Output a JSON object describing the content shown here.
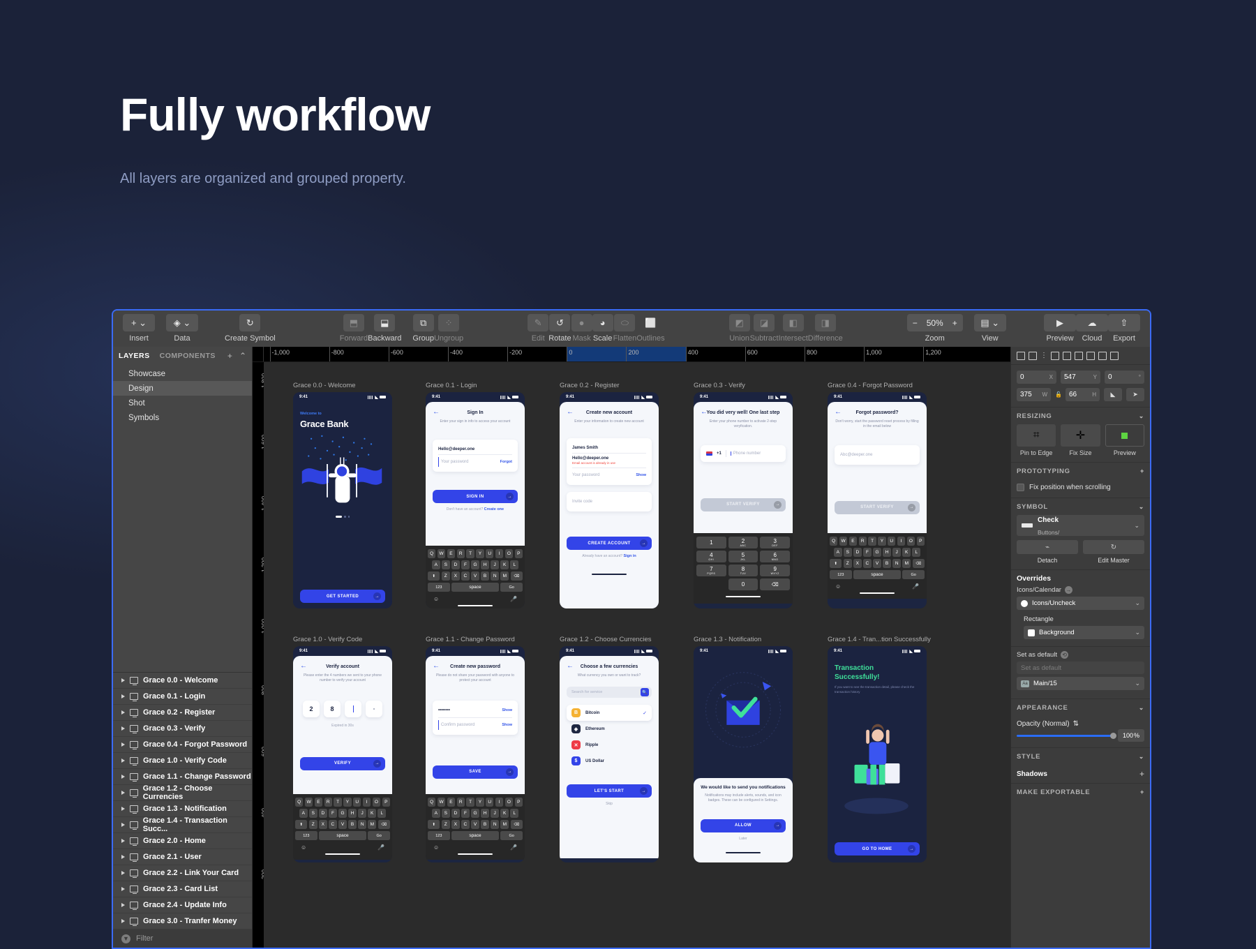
{
  "hero": {
    "title": "Fully workflow",
    "subtitle": "All layers are  organized and grouped property."
  },
  "toolbar": {
    "groups": [
      {
        "label": "Insert",
        "icon": "plus-icon",
        "dim": false
      },
      {
        "label": "Data",
        "icon": "layers-icon",
        "dim": false
      },
      {
        "label": "Create Symbol",
        "icon": "symbol-icon",
        "dim": false
      },
      {
        "label": "Forward",
        "icon": "forward-icon",
        "dim": true
      },
      {
        "label": "Backward",
        "icon": "backward-icon",
        "dim": false
      },
      {
        "label": "Group",
        "icon": "group-icon",
        "dim": false
      },
      {
        "label": "Ungroup",
        "icon": "ungroup-icon",
        "dim": true
      },
      {
        "label": "Edit",
        "icon": "edit-icon",
        "dim": true
      },
      {
        "label": "Rotate",
        "icon": "rotate-icon",
        "dim": false
      },
      {
        "label": "Mask",
        "icon": "mask-icon",
        "dim": true
      },
      {
        "label": "Scale",
        "icon": "scale-icon",
        "dim": false
      },
      {
        "label": "Flatten",
        "icon": "flatten-icon",
        "dim": true
      },
      {
        "label": "Outlines",
        "icon": "outlines-icon",
        "dim": true
      },
      {
        "label": "Union",
        "icon": "union-icon",
        "dim": true
      },
      {
        "label": "Subtract",
        "icon": "subtract-icon",
        "dim": true
      },
      {
        "label": "Intersect",
        "icon": "intersect-icon",
        "dim": true
      },
      {
        "label": "Difference",
        "icon": "difference-icon",
        "dim": true
      },
      {
        "label": "Zoom",
        "icon": "zoom-control",
        "dim": false
      },
      {
        "label": "View",
        "icon": "view-icon",
        "dim": false
      },
      {
        "label": "Preview",
        "icon": "play-icon",
        "dim": false
      },
      {
        "label": "Cloud",
        "icon": "cloud-icon",
        "dim": false
      },
      {
        "label": "Export",
        "icon": "export-icon",
        "dim": false
      }
    ],
    "zoom_value": "50%",
    "zoom_minus": "−",
    "zoom_plus": "+"
  },
  "left_panel": {
    "tabs": [
      {
        "label": "LAYERS",
        "active": true
      },
      {
        "label": "COMPONENTS",
        "active": false
      }
    ],
    "add_icon": "+",
    "collapse_icon": "⌃",
    "pages": [
      {
        "label": "Showcase",
        "selected": false
      },
      {
        "label": "Design",
        "selected": true
      },
      {
        "label": "Shot",
        "selected": false
      },
      {
        "label": "Symbols",
        "selected": false
      }
    ],
    "layers": [
      "Grace 0.0 - Welcome",
      "Grace 0.1 - Login",
      "Grace 0.2 - Register",
      "Grace 0.3 - Verify",
      "Grace 0.4 - Forgot Password",
      "Grace 1.0 - Verify Code",
      "Grace 1.1 - Change Password",
      "Grace 1.2 - Choose Currencies",
      "Grace 1.3 - Notification",
      "Grace 1.4 - Transaction Succ...",
      "Grace 2.0 - Home",
      "Grace 2.1 - User",
      "Grace 2.2 - Link Your Card",
      "Grace 2.3 - Card List",
      "Grace 2.4 - Update Info",
      "Grace 3.0 - Tranfer Money"
    ],
    "filter_label": "Filter"
  },
  "ruler": {
    "top_labels": [
      "-1,000",
      "-800",
      "-600",
      "-400",
      "-200",
      "0",
      "200",
      "400",
      "600",
      "800",
      "1,000",
      "1,200"
    ],
    "left_labels": [
      "-1,800",
      "-1,600",
      "-1,400",
      "-1,200",
      "-1,000",
      "-800",
      "-600",
      "-400",
      "-200"
    ]
  },
  "inspector": {
    "position": {
      "x_value": "0",
      "x_unit": "X",
      "y_value": "547",
      "y_unit": "Y",
      "rotation_value": "0",
      "rotation_unit": "°",
      "w_value": "375",
      "w_unit": "W",
      "h_value": "66",
      "h_unit": "H"
    },
    "resizing": {
      "title": "RESIZING",
      "items": [
        {
          "label": "Pin to Edge"
        },
        {
          "label": "Fix Size"
        },
        {
          "label": "Preview"
        }
      ]
    },
    "prototyping": {
      "title": "PROTOTYPING",
      "fix_position_label": "Fix position when scrolling"
    },
    "symbol": {
      "title": "SYMBOL",
      "name": "Check",
      "path": "Buttons/",
      "detach_label": "Detach",
      "edit_master_label": "Edit Master"
    },
    "overrides": {
      "title": "Overrides",
      "icons_calendar_label": "Icons/Calendar",
      "icons_uncheck_value": "Icons/Uncheck",
      "rectangle_label": "Rectangle",
      "background_value": "Background",
      "set_as_default_label": "Set as default",
      "set_as_default_placeholder": "Set as default",
      "text_style_value": "Main/15"
    },
    "appearance": {
      "title": "APPEARANCE",
      "opacity_label": "Opacity (Normal)",
      "opacity_value": "100",
      "opacity_unit": "%"
    },
    "style": {
      "title": "STYLE",
      "shadows_label": "Shadows"
    },
    "make_exportable": {
      "title": "MAKE EXPORTABLE"
    }
  },
  "artboards": [
    {
      "id": "welcome",
      "label": "Grace 0.0 - Welcome",
      "status_time": "9:41",
      "welcome_to": "Welcome to",
      "brand": "Grace Bank",
      "cta": "GET STARTED"
    },
    {
      "id": "login",
      "label": "Grace 0.1 - Login",
      "status_time": "9:41",
      "title": "Sign In",
      "subtitle": "Enter your sign in info to access your account",
      "email_value": "Hello@deeper.one",
      "password_placeholder": "Your password",
      "forgot_link": "Forgot",
      "cta": "SIGN IN",
      "footer_text": "Don't have an account?",
      "footer_link": "Create one",
      "keyboard": {
        "row1": [
          "Q",
          "W",
          "E",
          "R",
          "T",
          "Y",
          "U",
          "I",
          "O",
          "P"
        ],
        "row2": [
          "A",
          "S",
          "D",
          "F",
          "G",
          "H",
          "J",
          "K",
          "L"
        ],
        "row3": [
          "Z",
          "X",
          "C",
          "V",
          "B",
          "N",
          "M"
        ],
        "numbers_key": "123",
        "space_key": "space",
        "go_key": "Go"
      }
    },
    {
      "id": "register",
      "label": "Grace 0.2 - Register",
      "status_time": "9:41",
      "title": "Create new account",
      "subtitle": "Enter your information to create new account",
      "name_value": "James Smith",
      "email_value": "Hello@deeper.one",
      "email_error": "Email account is already in use",
      "password_placeholder": "Your password",
      "show_link": "Show",
      "invite_placeholder": "Invite code",
      "cta": "CREATE ACCOUNT",
      "footer_text": "Already have an account?",
      "footer_link": "Sign in"
    },
    {
      "id": "verify",
      "label": "Grace 0.3 - Verify",
      "status_time": "9:41",
      "title": "You did very well! One last step",
      "subtitle": "Enter your phone number to activate 2-step veryfication.",
      "country_code": "+1",
      "phone_placeholder": "Phone number",
      "cta": "START VERIFY",
      "numpad": [
        {
          "n": "1",
          "l": ""
        },
        {
          "n": "2",
          "l": "ABC"
        },
        {
          "n": "3",
          "l": "DEF"
        },
        {
          "n": "4",
          "l": "GHI"
        },
        {
          "n": "5",
          "l": "JKL"
        },
        {
          "n": "6",
          "l": "MNO"
        },
        {
          "n": "7",
          "l": "PQRS"
        },
        {
          "n": "8",
          "l": "TUV"
        },
        {
          "n": "9",
          "l": "WXYZ"
        },
        {
          "n": "0",
          "l": ""
        }
      ]
    },
    {
      "id": "forgot",
      "label": "Grace 0.4 - Forgot Password",
      "status_time": "9:41",
      "title": "Forgot password?",
      "subtitle": "Don't worry, start the password reset process by filling in the email below",
      "email_placeholder": "Abc@deeper.one",
      "cta": "START VERIFY"
    },
    {
      "id": "verifycode",
      "label": "Grace 1.0 - Verify Code",
      "status_time": "9:41",
      "title": "Verify account",
      "subtitle": "Please enter the 4 numbers we sent to your phone number to verify your account",
      "digits": [
        "2",
        "8",
        "",
        ""
      ],
      "expire_text": "Expired in 30s",
      "cta": "VERIFY"
    },
    {
      "id": "changepw",
      "label": "Grace 1.1 - Change Password",
      "status_time": "9:41",
      "title": "Create new password",
      "subtitle": "Please do not share your password with anyone to protect your account",
      "password_value": "••••••••",
      "confirm_placeholder": "Confirm password",
      "show_link": "Show",
      "cta": "SAVE"
    },
    {
      "id": "currencies",
      "label": "Grace 1.2 - Choose Currencies",
      "status_time": "9:41",
      "title": "Choose a few currencies",
      "subtitle": "What currency you own or want to track?",
      "search_placeholder": "Search for service",
      "items": [
        {
          "name": "Bitcoin",
          "symbol": "B",
          "color": "#f5b233",
          "selected": true
        },
        {
          "name": "Ethereum",
          "symbol": "◈",
          "color": "#1e2741",
          "selected": false
        },
        {
          "name": "Ripple",
          "symbol": "✕",
          "color": "#ee3b46",
          "selected": false
        },
        {
          "name": "US Dollar",
          "symbol": "$",
          "color": "#3344e8",
          "selected": false
        }
      ],
      "cta": "LET'S START",
      "skip_label": "Skip"
    },
    {
      "id": "notification",
      "label": "Grace 1.3 - Notification",
      "status_time": "9:41",
      "title": "We would like to send you notifications",
      "subtitle": "Notifications may include alerts, sounds, and icon badges. These can be configured in Settings.",
      "cta": "ALLOW",
      "later_label": "Later"
    },
    {
      "id": "transaction",
      "label": "Grace 1.4 - Tran...tion Successfully",
      "status_time": "9:41",
      "title_line1": "Transaction",
      "title_line2": "Successfully!",
      "subtitle": "If you want to see the transaction detail, please check the transaction history",
      "cta": "GO TO HOME"
    }
  ],
  "colors": {
    "accent_blue": "#3344e8",
    "canvas_bg": "#2b2b2b",
    "panel_bg": "#3c3c3c",
    "window_border": "#3b6bf5",
    "page_bg": "#1b2239"
  }
}
